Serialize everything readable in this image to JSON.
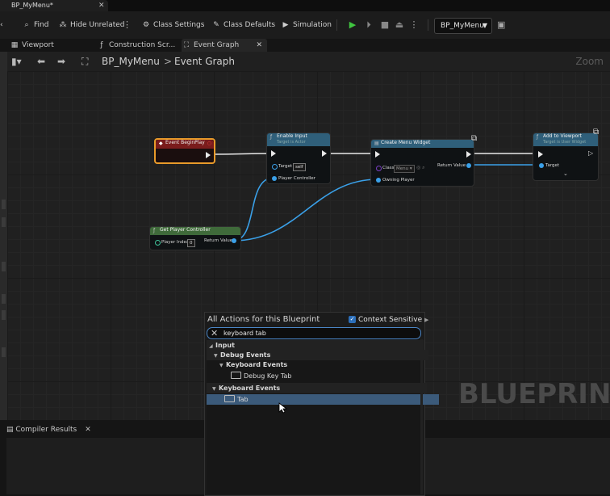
{
  "window": {
    "doc_tab_title": "BP_MyMenu*"
  },
  "toolbar": {
    "find": "Find",
    "hide_unrelated": "Hide Unrelated",
    "class_settings": "Class Settings",
    "class_defaults": "Class Defaults",
    "simulation": "Simulation",
    "debug_target": "BP_MyMenu"
  },
  "editor_tabs": [
    {
      "label": "Viewport"
    },
    {
      "label": "Construction Scr..."
    },
    {
      "label": "Event Graph"
    }
  ],
  "graph_header": {
    "breadcrumb_root": "BP_MyMenu",
    "breadcrumb_separator": ">",
    "breadcrumb_leaf": "Event Graph",
    "zoom": "Zoom"
  },
  "graph": {
    "watermark": "BLUEPRINT",
    "nodes": {
      "event_begin_play": {
        "title": "Event BeginPlay"
      },
      "enable_input": {
        "title": "Enable Input",
        "subtitle": "Target is Actor",
        "target_label": "Target",
        "target_value": "self",
        "player_controller_label": "Player Controller"
      },
      "create_menu_widget": {
        "title": "Create Menu Widget",
        "class_label": "Class",
        "class_value": "Menu",
        "owning_player_label": "Owning Player",
        "return_value_label": "Return Value"
      },
      "add_to_viewport": {
        "title": "Add to Viewport",
        "subtitle": "Target is User Widget",
        "target_label": "Target"
      },
      "get_player_controller": {
        "title": "Get Player Controller",
        "player_index_label": "Player Index",
        "player_index_value": "0",
        "return_value_label": "Return Value"
      }
    },
    "colors": {
      "event_head": "#7a1c1c",
      "function_head": "#2f5f7a",
      "pure_head": "#3f6a3a",
      "wire_data": "#3aa0e8",
      "wire_exec": "#e8e8e8",
      "selection_outline": "#e89a2a"
    }
  },
  "action_menu": {
    "title": "All Actions for this Blueprint",
    "context_sensitive_label": "Context Sensitive",
    "context_sensitive_checked": true,
    "search_value": "keyboard tab",
    "items": [
      {
        "label": "Input"
      },
      {
        "label": "Debug Events"
      },
      {
        "label": "Keyboard Events"
      },
      {
        "label": "Debug Key Tab"
      },
      {
        "label": "Keyboard Events"
      },
      {
        "label": "Tab"
      }
    ]
  },
  "bottom_panel": {
    "compiler_results": "Compiler Results"
  }
}
